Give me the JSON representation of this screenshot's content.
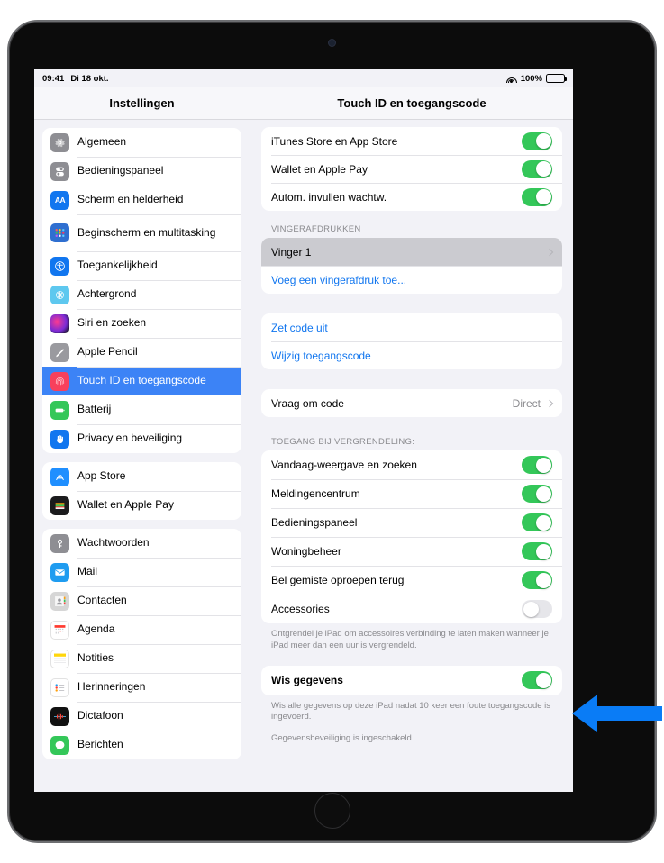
{
  "statusbar": {
    "time": "09:41",
    "date": "Di 18 okt.",
    "battery_percent": "100%",
    "wifi_icon": "wifi-icon",
    "battery_icon": "battery-icon"
  },
  "sidebar": {
    "title": "Instellingen",
    "groups": [
      {
        "items": [
          {
            "label": "Algemeen",
            "icon": "gear-icon"
          },
          {
            "label": "Bedieningspaneel",
            "icon": "control-center-icon"
          },
          {
            "label": "Scherm en helderheid",
            "icon": "display-brightness-icon"
          },
          {
            "label": "Beginscherm en multitasking",
            "icon": "home-screen-icon"
          },
          {
            "label": "Toegankelijkheid",
            "icon": "accessibility-icon"
          },
          {
            "label": "Achtergrond",
            "icon": "wallpaper-icon"
          },
          {
            "label": "Siri en zoeken",
            "icon": "siri-icon"
          },
          {
            "label": "Apple Pencil",
            "icon": "pencil-icon"
          },
          {
            "label": "Touch ID en toegangscode",
            "icon": "touch-id-icon"
          },
          {
            "label": "Batterij",
            "icon": "battery-icon"
          },
          {
            "label": "Privacy en beveiliging",
            "icon": "privacy-hand-icon"
          }
        ]
      },
      {
        "items": [
          {
            "label": "App Store",
            "icon": "app-store-icon"
          },
          {
            "label": "Wallet en Apple Pay",
            "icon": "wallet-icon"
          }
        ]
      },
      {
        "items": [
          {
            "label": "Wachtwoorden",
            "icon": "key-icon"
          },
          {
            "label": "Mail",
            "icon": "mail-icon"
          },
          {
            "label": "Contacten",
            "icon": "contacts-icon"
          },
          {
            "label": "Agenda",
            "icon": "calendar-icon"
          },
          {
            "label": "Notities",
            "icon": "notes-icon"
          },
          {
            "label": "Herinneringen",
            "icon": "reminders-icon"
          },
          {
            "label": "Dictafoon",
            "icon": "voice-memos-icon"
          },
          {
            "label": "Berichten",
            "icon": "messages-icon"
          }
        ]
      }
    ],
    "selected": "Touch ID en toegangscode"
  },
  "detail": {
    "title": "Touch ID en toegangscode",
    "group_use_touchid": [
      {
        "label": "iTunes Store en App Store",
        "toggle": "on"
      },
      {
        "label": "Wallet en Apple Pay",
        "toggle": "on"
      },
      {
        "label": "Autom. invullen wachtw.",
        "toggle": "on"
      }
    ],
    "fingerprints_header": "VINGERAFDRUKKEN",
    "fingerprints": [
      {
        "label": "Vinger 1",
        "accessory": "chevron",
        "highlighted": true
      },
      {
        "label": "Voeg een vingerafdruk toe...",
        "style": "link"
      }
    ],
    "passcode_actions": [
      {
        "label": "Zet code uit",
        "style": "link"
      },
      {
        "label": "Wijzig toegangscode",
        "style": "link"
      }
    ],
    "require_passcode": {
      "label": "Vraag om code",
      "value": "Direct",
      "accessory": "chevron"
    },
    "lock_access_header": "TOEGANG BIJ VERGRENDELING:",
    "lock_access": [
      {
        "label": "Vandaag-weergave en zoeken",
        "toggle": "on"
      },
      {
        "label": "Meldingencentrum",
        "toggle": "on"
      },
      {
        "label": "Bedieningspaneel",
        "toggle": "on"
      },
      {
        "label": "Woningbeheer",
        "toggle": "on"
      },
      {
        "label": "Bel gemiste oproepen terug",
        "toggle": "on"
      },
      {
        "label": "Accessories",
        "toggle": "off"
      }
    ],
    "accessories_footnote": "Ontgrendel je iPad om accessoires verbinding te laten maken wanneer je iPad meer dan een uur is vergrendeld.",
    "erase_data": {
      "label": "Wis gegevens",
      "toggle": "on"
    },
    "erase_footnote": "Wis alle gegevens op deze iPad nadat 10 keer een foute toegangscode is ingevoerd.",
    "data_protection_note": "Gegevensbeveiliging is ingeschakeld."
  },
  "annotation": {
    "arrow_icon": "left-arrow-annotation",
    "arrow_color": "#0a7cf6",
    "points_to": "Wis gegevens"
  },
  "colors": {
    "accent_blue": "#1176ef",
    "selected_row_blue": "#3c83f6",
    "toggle_green": "#34c759",
    "toggle_off_gray": "#e6e6ea",
    "page_background": "#f2f2f7",
    "card_background": "#ffffff",
    "secondary_text": "#8a8a8e"
  }
}
